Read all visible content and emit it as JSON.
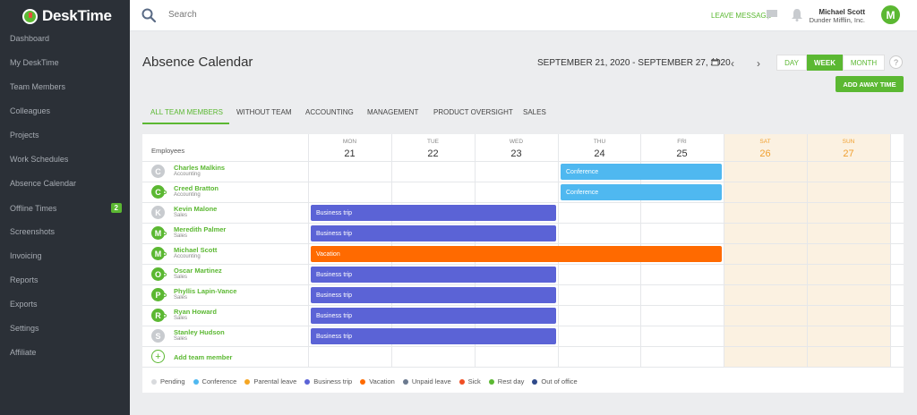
{
  "app": {
    "name": "DeskTime"
  },
  "sidebar": {
    "items": [
      {
        "label": "Dashboard"
      },
      {
        "label": "My DeskTime"
      },
      {
        "label": "Team Members"
      },
      {
        "label": "Colleagues"
      },
      {
        "label": "Projects"
      },
      {
        "label": "Work Schedules"
      },
      {
        "label": "Absence Calendar"
      },
      {
        "label": "Offline Times",
        "badge": "2"
      },
      {
        "label": "Screenshots"
      },
      {
        "label": "Invoicing"
      },
      {
        "label": "Reports"
      },
      {
        "label": "Exports"
      },
      {
        "label": "Settings"
      },
      {
        "label": "Affiliate"
      }
    ]
  },
  "topbar": {
    "search_placeholder": "Search",
    "leave_message": "LEAVE MESSAGE",
    "user_name": "Michael Scott",
    "company": "Dunder Mifflin, Inc.",
    "avatar_letter": "M"
  },
  "page": {
    "title": "Absence Calendar",
    "date_range": "SEPTEMBER 21, 2020 - SEPTEMBER 27, 2020",
    "views": [
      "DAY",
      "WEEK",
      "MONTH"
    ],
    "active_view": "WEEK",
    "help": "?",
    "add_away_time": "ADD AWAY TIME"
  },
  "tabs": [
    "ALL TEAM MEMBERS",
    "WITHOUT TEAM",
    "ACCOUNTING",
    "MANAGEMENT",
    "PRODUCT OVERSIGHT",
    "SALES"
  ],
  "calendar": {
    "employees_header": "Employees",
    "days": [
      {
        "name": "MON",
        "num": "21"
      },
      {
        "name": "TUE",
        "num": "22"
      },
      {
        "name": "WED",
        "num": "23"
      },
      {
        "name": "THU",
        "num": "24"
      },
      {
        "name": "FRI",
        "num": "25"
      },
      {
        "name": "SAT",
        "num": "26"
      },
      {
        "name": "SUN",
        "num": "27"
      }
    ],
    "employees": [
      {
        "name": "Charles Malkins",
        "dept": "Accounting",
        "initial": "C",
        "active": false,
        "absence": {
          "label": "Conference",
          "start": 3,
          "end": 4,
          "type": "conference"
        }
      },
      {
        "name": "Creed Bratton",
        "dept": "Accounting",
        "initial": "C",
        "active": true,
        "absence": {
          "label": "Conference",
          "start": 3,
          "end": 4,
          "type": "conference"
        }
      },
      {
        "name": "Kevin Malone",
        "dept": "Sales",
        "initial": "K",
        "active": false,
        "absence": {
          "label": "Business trip",
          "start": 0,
          "end": 2,
          "type": "business"
        }
      },
      {
        "name": "Meredith Palmer",
        "dept": "Sales",
        "initial": "M",
        "active": true,
        "absence": {
          "label": "Business trip",
          "start": 0,
          "end": 2,
          "type": "business"
        }
      },
      {
        "name": "Michael Scott",
        "dept": "Accounting",
        "initial": "M",
        "active": true,
        "absence": {
          "label": "Vacation",
          "start": 0,
          "end": 4,
          "type": "vacation"
        }
      },
      {
        "name": "Oscar Martinez",
        "dept": "Sales",
        "initial": "O",
        "active": true,
        "absence": {
          "label": "Business trip",
          "start": 0,
          "end": 2,
          "type": "business"
        }
      },
      {
        "name": "Phyllis Lapin-Vance",
        "dept": "Sales",
        "initial": "P",
        "active": true,
        "absence": {
          "label": "Business trip",
          "start": 0,
          "end": 2,
          "type": "business"
        }
      },
      {
        "name": "Ryan Howard",
        "dept": "Sales",
        "initial": "R",
        "active": true,
        "absence": {
          "label": "Business trip",
          "start": 0,
          "end": 2,
          "type": "business"
        }
      },
      {
        "name": "Stanley Hudson",
        "dept": "Sales",
        "initial": "S",
        "active": false,
        "absence": {
          "label": "Business trip",
          "start": 0,
          "end": 2,
          "type": "business"
        }
      }
    ],
    "add_member": "Add team member"
  },
  "legend": [
    {
      "label": "Pending",
      "color": "#d8dadd"
    },
    {
      "label": "Conference",
      "color": "#4fb8f0"
    },
    {
      "label": "Parental leave",
      "color": "#f5a623"
    },
    {
      "label": "Business trip",
      "color": "#5b63d6"
    },
    {
      "label": "Vacation",
      "color": "#ff6a00"
    },
    {
      "label": "Unpaid leave",
      "color": "#6b7a8f"
    },
    {
      "label": "Sick",
      "color": "#f04e23"
    },
    {
      "label": "Rest day",
      "color": "#5bb832"
    },
    {
      "label": "Out of office",
      "color": "#2f4a8a"
    }
  ],
  "colors": {
    "accent": "#5bb832",
    "conference": "#4fb8f0",
    "business": "#5b63d6",
    "vacation": "#ff6a00",
    "inactive_avatar": "#c8cbcf",
    "weekend_num": "#f0a030"
  }
}
